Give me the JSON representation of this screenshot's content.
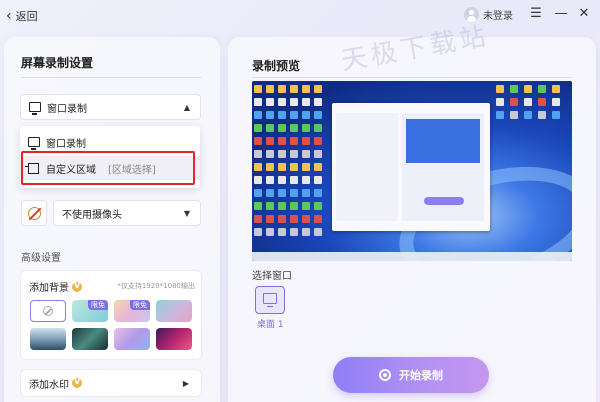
{
  "topbar": {
    "back_label": "返回",
    "user_label": "未登录"
  },
  "left": {
    "title": "屏幕录制设置",
    "mode_selected": "窗口录制",
    "options": [
      {
        "label": "窗口录制",
        "hint": ""
      },
      {
        "label": "自定义区域",
        "hint": "[区域选择]"
      }
    ],
    "camera_label": "不使用摄像头",
    "advanced_title": "高级设置",
    "background_title": "添加背景",
    "background_note": "*仅支持1920*1080输出",
    "free_tag": "限免",
    "watermark_label": "添加水印"
  },
  "right": {
    "title": "录制预览",
    "choose_window_label": "选择窗口",
    "desktop_label": "桌面 1",
    "start_button": "开始录制",
    "watermark_text": "天极下载站"
  },
  "colors": {
    "accent": "#7e6fe6",
    "highlight_box": "#e0262a"
  }
}
